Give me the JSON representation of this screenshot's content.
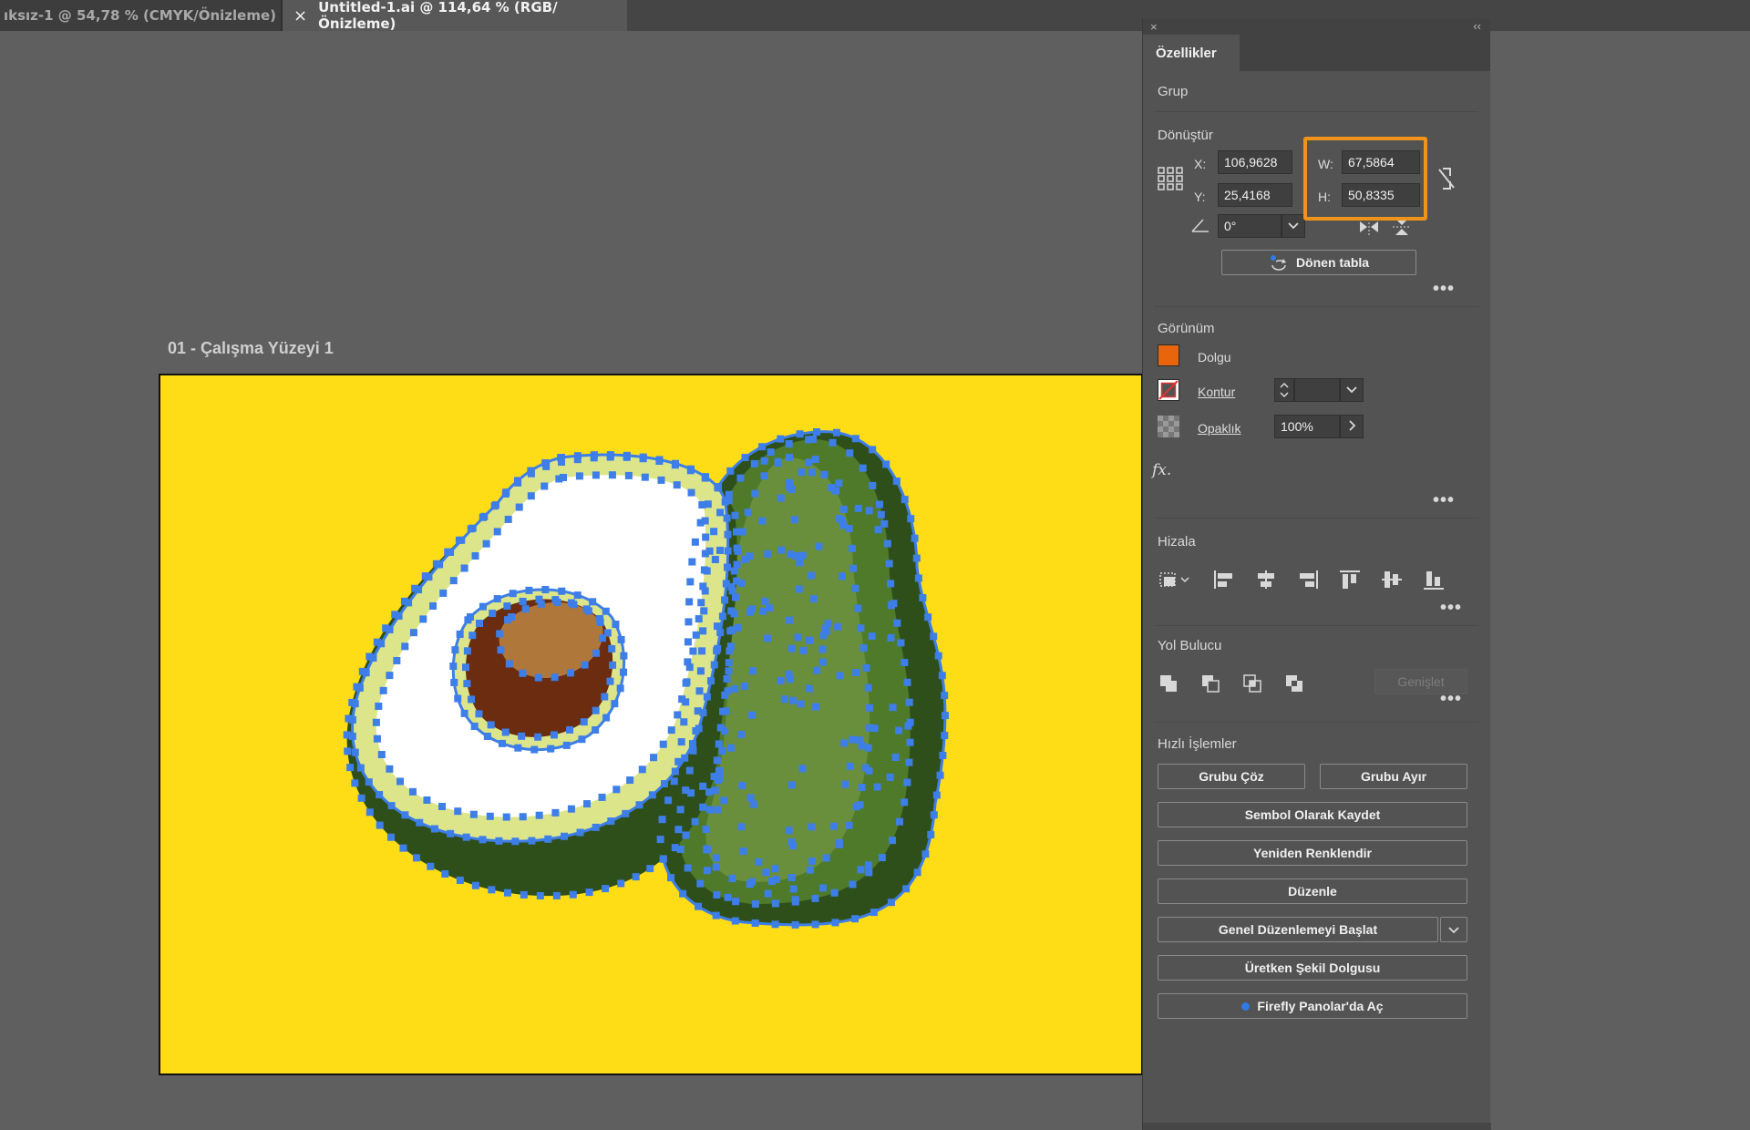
{
  "tabs": {
    "tab1_label": "ıksız-1 @ 54,78 % (CMYK/Önizleme)",
    "tab2_close": "×",
    "tab2_label": "Untitled-1.ai @ 114,64 % (RGB/Önizleme)"
  },
  "canvas": {
    "artboard_label": "01 - Çalışma Yüzeyi 1",
    "artboard_color": "#fedd17"
  },
  "panel": {
    "close_glyph": "×",
    "collapse_glyph": "‹‹",
    "tab_label": "Özellikler",
    "selection_type": "Grup",
    "transform": {
      "title": "Dönüştür",
      "x_label": "X:",
      "x_value": "106,9628",
      "y_label": "Y:",
      "y_value": "25,4168",
      "w_label": "W:",
      "w_value": "67,5864",
      "h_label": "H:",
      "h_value": "50,8335",
      "angle_value": "0°",
      "donen_tabla_label": "Dönen tabla",
      "more": "•••"
    },
    "appearance": {
      "title": "Görünüm",
      "fill_label": "Dolgu",
      "fill_color": "#e8650c",
      "stroke_label": "Kontur",
      "opacity_label": "Opaklık",
      "opacity_value": "100%",
      "fx_label": "fx.",
      "more": "•••"
    },
    "align": {
      "title": "Hizala",
      "more": "•••"
    },
    "pathfinder": {
      "title": "Yol Bulucu",
      "expand_label": "Genişlet",
      "more": "•••"
    },
    "quick_actions": {
      "title": "Hızlı İşlemler",
      "ungroup": "Grubu Çöz",
      "isolate": "Grubu Ayır",
      "save_symbol": "Sembol Olarak Kaydet",
      "recolor": "Yeniden Renklendir",
      "edit": "Düzenle",
      "global_edit": "Genel Düzenlemeyi Başlat",
      "generative_fill": "Üretken Şekil Dolgusu",
      "firefly": "Firefly Panolar'da Aç"
    }
  },
  "colors": {
    "highlight": "#f0931a",
    "selection": "#3d7ee8",
    "accent_blue": "#2f7ae5"
  }
}
